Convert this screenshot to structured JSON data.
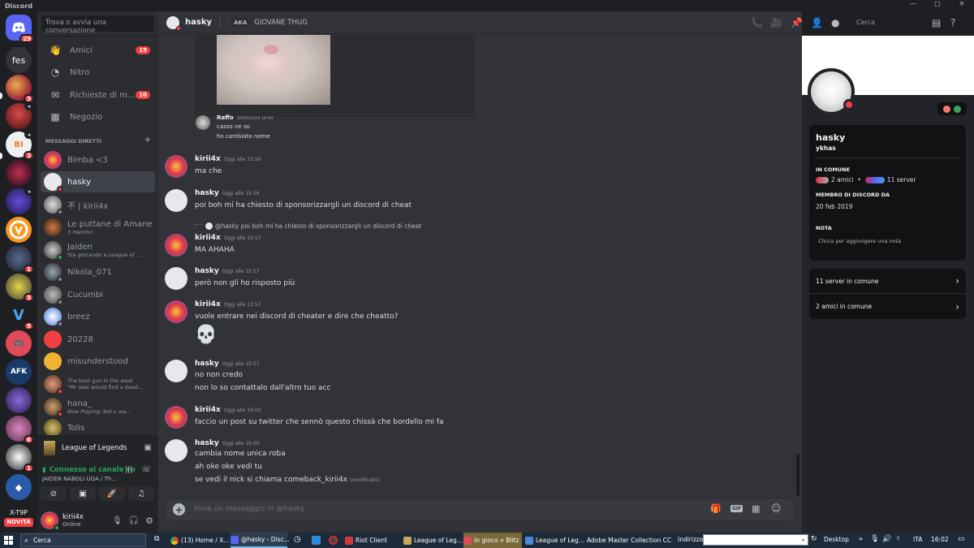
{
  "app_title": "Discord",
  "colors": {
    "accent": "#5865f2",
    "danger": "#f23f43",
    "online": "#23a55a",
    "background": "#313338"
  },
  "servers": {
    "home_badge": "29",
    "text_server": "fes",
    "badges": [
      "3",
      "1",
      "3",
      "1",
      "5",
      "6",
      "1"
    ],
    "bottom_label": "X-T9P",
    "bottom_badge": "NOVITÀ"
  },
  "sidebar": {
    "search_placeholder": "Trova o avvia una conversazione",
    "nav": [
      {
        "label": "Amici",
        "badge": "19",
        "icon": "friends-icon"
      },
      {
        "label": "Nitro",
        "badge": "",
        "icon": "nitro-icon"
      },
      {
        "label": "Richieste di mes...",
        "badge": "10",
        "icon": "message-requests-icon"
      },
      {
        "label": "Negozio",
        "badge": "",
        "icon": "shop-icon"
      }
    ],
    "dm_header": "MESSAGGI DIRETTI",
    "dm_add": "+",
    "dms": [
      {
        "name": "Bimba <3",
        "sub": ""
      },
      {
        "name": "hasky",
        "sub": ""
      },
      {
        "name": "不 | kirii4x",
        "sub": ""
      },
      {
        "name": "Le puttane di Amane",
        "sub": "3 membri"
      },
      {
        "name": "Jaiden",
        "sub": "Sta giocando a League of ..."
      },
      {
        "name": "Nikola_071",
        "sub": ""
      },
      {
        "name": "Cucumbi",
        "sub": ""
      },
      {
        "name": "breez",
        "sub": ""
      },
      {
        "name": "20228",
        "sub": ""
      },
      {
        "name": "misunderstood",
        "sub": ""
      },
      {
        "name": "The best gun in the west",
        "sub": "\"Mr alex would find a dead..."
      },
      {
        "name": "hana_",
        "sub": "Now Playing: bot u wa..."
      },
      {
        "name": "Tolis",
        "sub": ""
      }
    ],
    "game": "League of Legends",
    "voice_status": "Connesso al canale vo",
    "voice_channel": "JAIDEN NABOLI UGA / Th...",
    "user_name": "kirii4x",
    "user_status": "Online"
  },
  "chat": {
    "header_name": "hasky",
    "aka_label": "AKA",
    "aka_value": "GIOVANE THUG",
    "search_placeholder": "Cerca",
    "composer_placeholder": "Invia un messaggio in @hasky",
    "embed_author": "Raffo",
    "embed_time": "19/03/2024 18:44",
    "embed_lines": [
      "cazzo ne so",
      "ho cambiato nome"
    ],
    "reply_text": "@hasky poi boh mi ha chiesto di sponsorizzargli un discord di cheat",
    "messages": [
      {
        "author": "kirii4x",
        "time": "Oggi alle 15:56",
        "lines": [
          "ma che"
        ]
      },
      {
        "author": "hasky",
        "time": "Oggi alle 15:56",
        "lines": [
          "poi boh mi ha chiesto di sponsorizzargli un discord di cheat"
        ]
      },
      {
        "author": "kirii4x",
        "time": "Oggi alle 15:57",
        "lines": [
          "MA AHAHA"
        ]
      },
      {
        "author": "hasky",
        "time": "Oggi alle 15:57",
        "lines": [
          "però non gli ho risposto più"
        ]
      },
      {
        "author": "kirii4x",
        "time": "Oggi alle 15:57",
        "lines": [
          "vuole entrare nei discord di cheater e dire che cheatto?"
        ]
      },
      {
        "author": "hasky",
        "time": "Oggi alle 15:57",
        "lines": [
          "no non credo",
          "non lo so contattalo dall'altro tuo acc"
        ]
      },
      {
        "author": "kirii4x",
        "time": "Oggi alle 16:00",
        "lines": [
          "faccio un post su twitter che sennò questo chissà che bordello mi fa"
        ]
      },
      {
        "author": "hasky",
        "time": "Oggi alle 16:00",
        "lines": [
          "cambia nome unica roba",
          "ah oke oke vedi tu",
          "se vedi il nick si chiama comeback_kirii4x"
        ]
      }
    ],
    "edited_label": "(modificato)",
    "skull": "💀"
  },
  "profile": {
    "display_name": "hasky",
    "username": "ykhas",
    "common_title": "IN COMUNE",
    "common_friends": "2 amici",
    "common_servers": "11 server",
    "member_title": "MEMBRO DI DISCORD DA",
    "member_since": "20 feb 2019",
    "note_title": "NOTA",
    "note_placeholder": "Clicca per aggiungere una nota",
    "servers_link": "11 server in comune",
    "friends_link": "2 amici in comune"
  },
  "taskbar": {
    "search": "Cerca",
    "items": [
      "(13) Home / X...",
      "@hasky - Disc...",
      "Riot Client",
      "League of Leg...",
      "In gioco ⟡ Blitz",
      "League of Leg...",
      "Adobe Master Collection CC"
    ],
    "address_label": "Indirizzo",
    "desktop": "Desktop",
    "lang": "ITA",
    "time": "16:02"
  }
}
